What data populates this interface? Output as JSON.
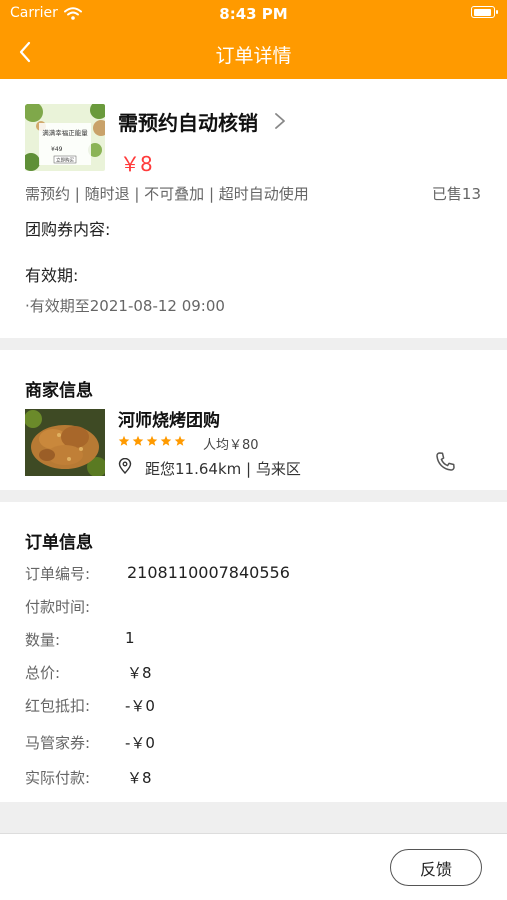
{
  "status_bar": {
    "carrier": "Carrier",
    "time": "8:43 PM"
  },
  "header": {
    "title": "订单详情",
    "back_icon": "chevron-left-icon"
  },
  "product": {
    "name": "需预约自动核销",
    "price": "￥8",
    "tags": "需预约 | 随时退 | 不可叠加 | 超时自动使用",
    "sold": "已售13",
    "content_label": "团购券内容:",
    "validity_label": "有效期:",
    "validity_value": "·有效期至2021-08-12 09:00",
    "thumb_text": {
      "line1": "满满幸福正能量",
      "line2": "¥49",
      "button": "立即购买"
    }
  },
  "merchant": {
    "section_title": "商家信息",
    "name": "河师烧烤团购",
    "rating": 5,
    "avg_price": "人均￥80",
    "location": "距您11.64km | 乌来区",
    "icons": [
      "star-icon",
      "location-pin-icon",
      "phone-icon"
    ]
  },
  "order": {
    "section_title": "订单信息",
    "rows": [
      {
        "label": "订单编号:",
        "value": "2108110007840556"
      },
      {
        "label": "付款时间:",
        "value": ""
      },
      {
        "label": "数量:",
        "value": "1"
      },
      {
        "label": "总价:",
        "value": "￥8"
      },
      {
        "label": "红包抵扣:",
        "value": "-￥0"
      },
      {
        "label": "马管家券:",
        "value": "-￥0"
      },
      {
        "label": "实际付款:",
        "value": "￥8"
      }
    ]
  },
  "footer": {
    "feedback_label": "反馈"
  },
  "colors": {
    "brand": "#ff9a00",
    "price": "#ff3a3a",
    "star": "#ff9a00"
  }
}
